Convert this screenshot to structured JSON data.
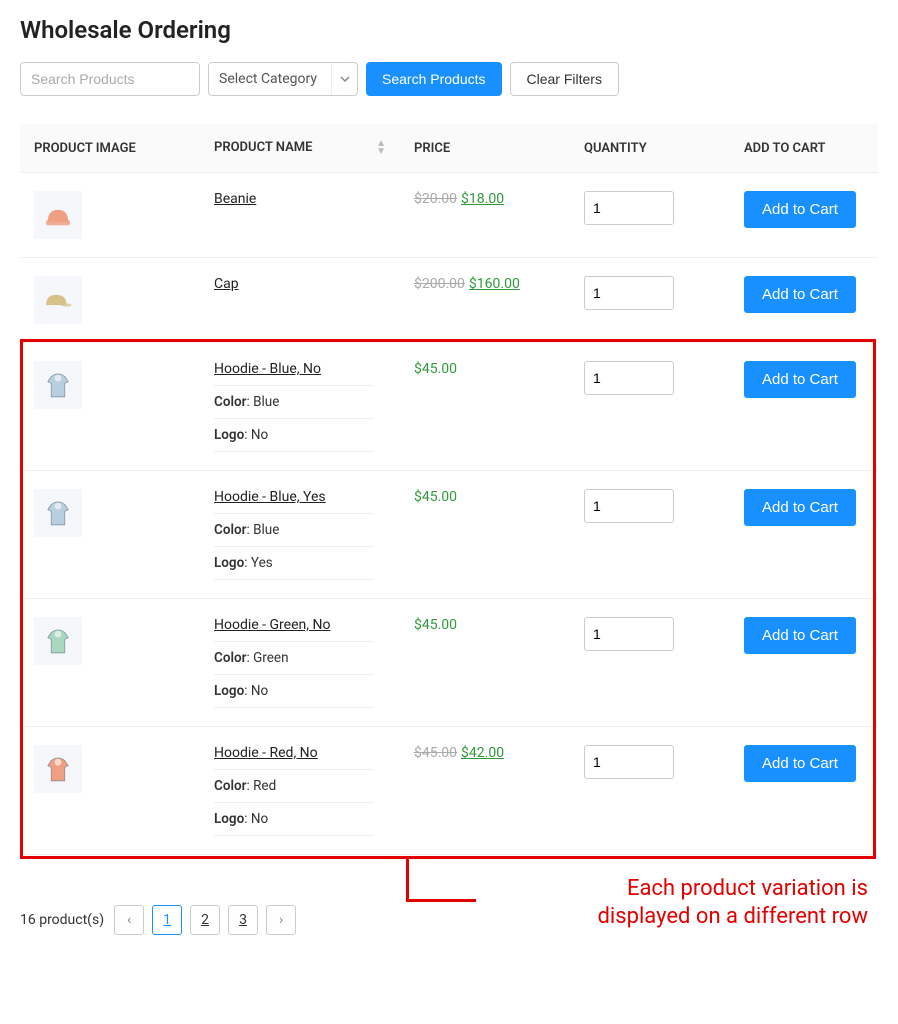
{
  "title": "Wholesale Ordering",
  "filters": {
    "search_placeholder": "Search Products",
    "category_placeholder": "Select Category",
    "search_btn": "Search Products",
    "clear_btn": "Clear Filters"
  },
  "columns": {
    "image": "PRODUCT IMAGE",
    "name": "PRODUCT NAME",
    "price": "PRICE",
    "qty": "QUANTITY",
    "action": "ADD TO CART"
  },
  "add_to_cart_label": "Add to Cart",
  "attr_labels": {
    "color": "Color",
    "logo": "Logo"
  },
  "products": [
    {
      "name": "Beanie",
      "old_price": "$20.00",
      "new_price": "$18.00",
      "qty": "1",
      "icon_color": "#f0a080"
    },
    {
      "name": "Cap",
      "old_price": "$200.00",
      "new_price": "$160.00",
      "qty": "1",
      "icon_color": "#d6c189"
    },
    {
      "name": "Hoodie - Blue, No",
      "price": "$45.00",
      "qty": "1",
      "icon_color": "#b8cfe0",
      "attrs": {
        "color": "Blue",
        "logo": "No"
      }
    },
    {
      "name": "Hoodie - Blue, Yes",
      "price": "$45.00",
      "qty": "1",
      "icon_color": "#b8cfe0",
      "attrs": {
        "color": "Blue",
        "logo": "Yes"
      }
    },
    {
      "name": "Hoodie - Green, No",
      "price": "$45.00",
      "qty": "1",
      "icon_color": "#a8d8c0",
      "attrs": {
        "color": "Green",
        "logo": "No"
      }
    },
    {
      "name": "Hoodie - Red, No",
      "old_price": "$45.00",
      "new_price": "$42.00",
      "qty": "1",
      "icon_color": "#f0a080",
      "attrs": {
        "color": "Red",
        "logo": "No"
      }
    }
  ],
  "pagination": {
    "count_text": "16 product(s)",
    "pages": [
      "1",
      "2",
      "3"
    ],
    "active": "1",
    "prev": "‹",
    "next": "›"
  },
  "callout": "Each product variation is\ndisplayed on a different row"
}
